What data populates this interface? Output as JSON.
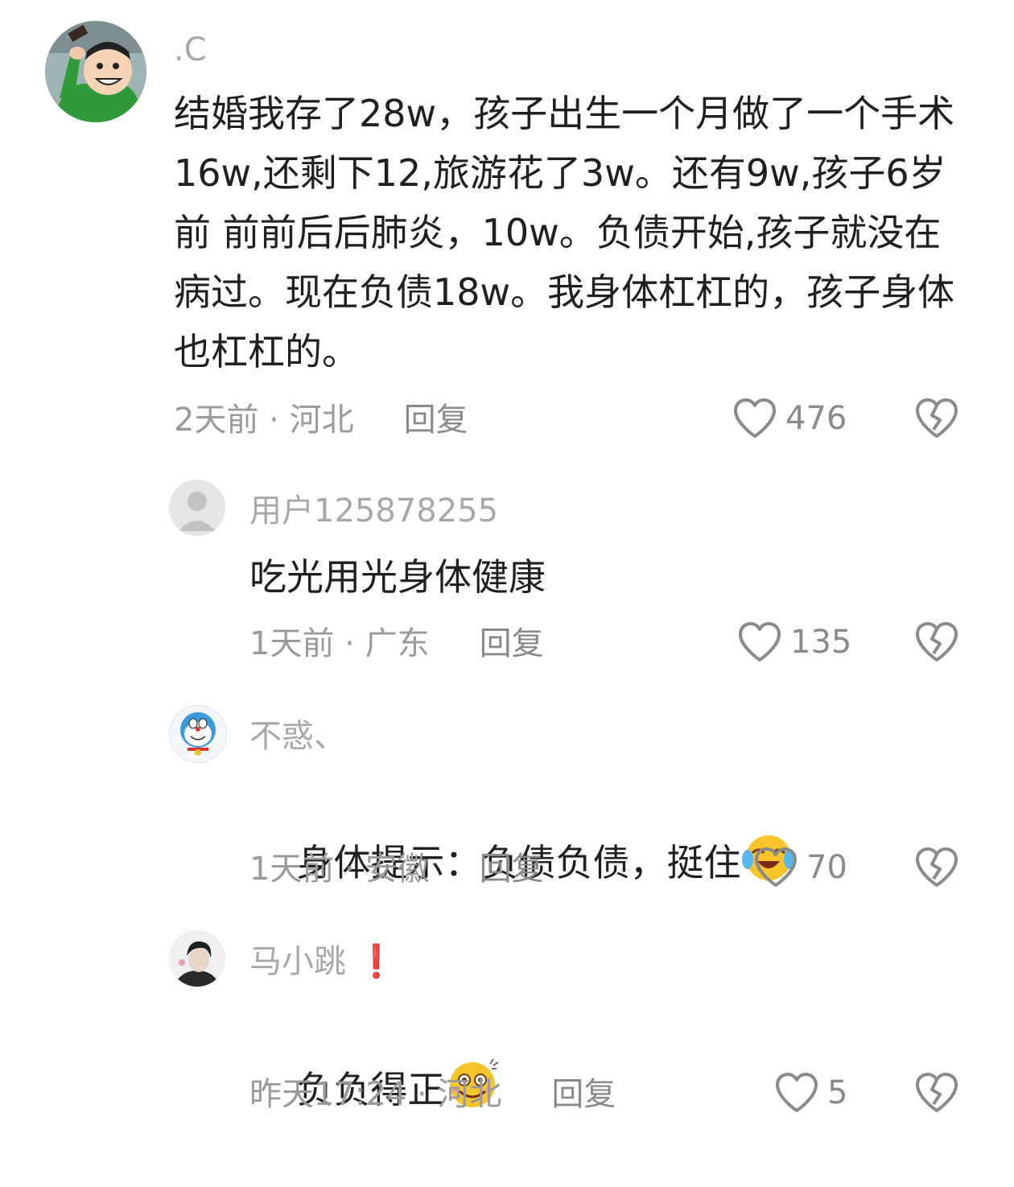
{
  "comments": [
    {
      "username": ".C",
      "text": "结婚我存了28w，孩子出生一个月做了一个手术16w,还剩下12,旅游花了3w。还有9w,孩子6岁前 前前后后肺炎，10w。负债开始,孩子就没在病过。现在负债18w。我身体杠杠的，孩子身体也杠杠的。",
      "meta": "2天前 · 河北",
      "reply": "回复",
      "likes": "476"
    },
    {
      "username": "用户125878255",
      "text": "吃光用光身体健康",
      "meta": "1天前 · 广东",
      "reply": "回复",
      "likes": "135"
    },
    {
      "username": "不惑、",
      "text": "身体提示：负债负债，挺住",
      "emoji": "crying-laughing-emoji",
      "meta": "1天前 · 安徽",
      "reply": "回复",
      "likes": "70"
    },
    {
      "username": "马小跳",
      "username_suffix": "❗",
      "text": "负负得正",
      "emoji": "dizzy-smile-emoji",
      "meta": "昨天17:24 · 河北",
      "reply": "回复",
      "likes": "5"
    }
  ],
  "icons": {
    "like": "heart-outline-icon",
    "dislike": "broken-heart-icon"
  },
  "colors": {
    "text": "#202020",
    "secondary": "#9a9a9a",
    "icon": "#8a8a8a"
  }
}
